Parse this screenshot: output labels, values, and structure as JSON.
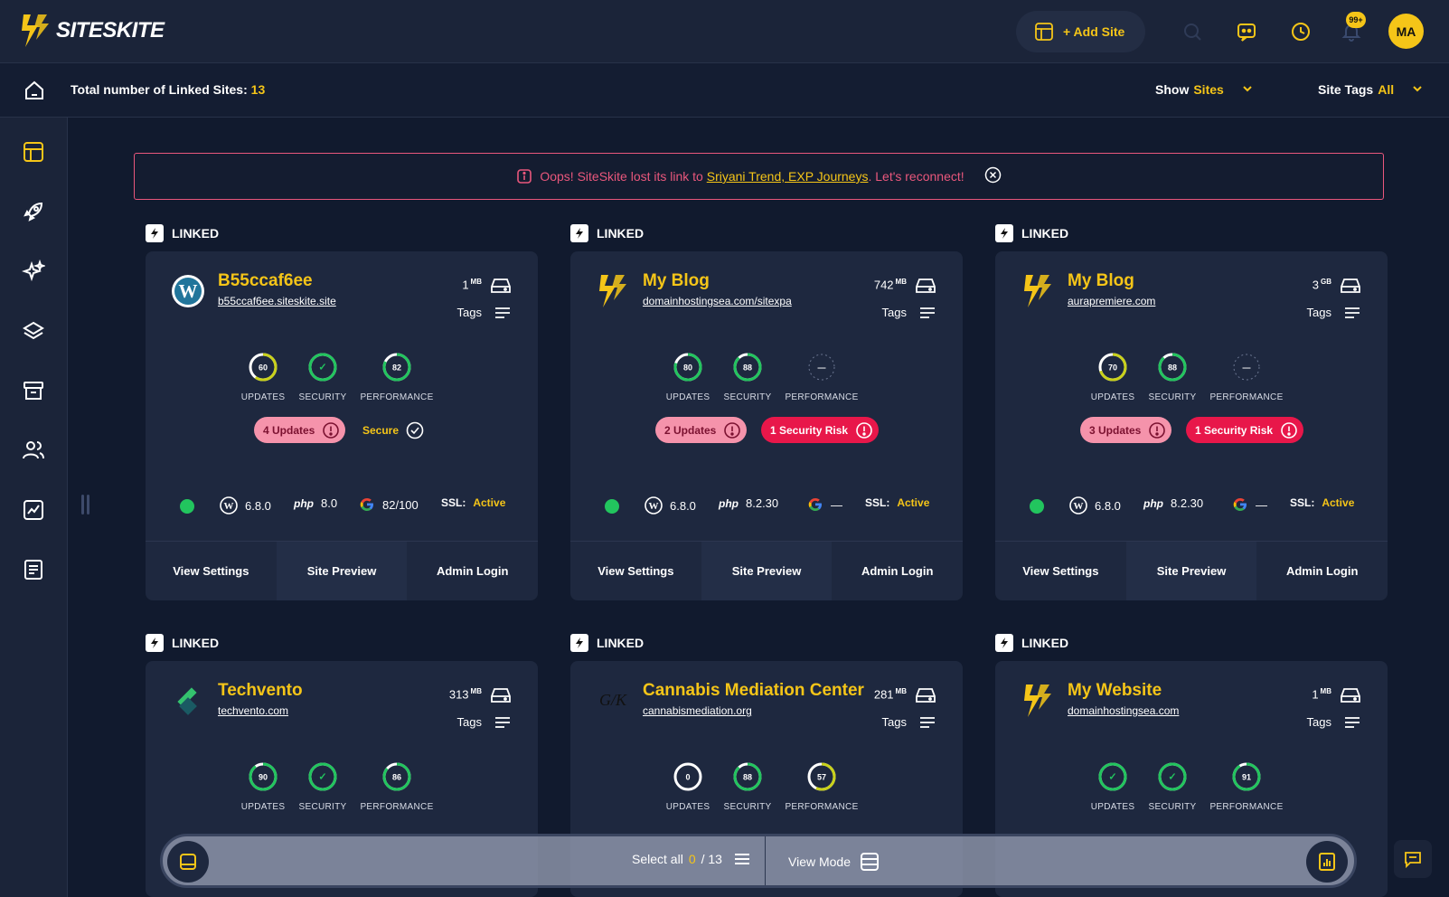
{
  "app": {
    "name": "SITESKITE"
  },
  "topbar": {
    "add_site_label": "+ Add Site",
    "notification_count": "99+",
    "avatar_initials": "MA"
  },
  "subbar": {
    "total_label": "Total number of Linked Sites:",
    "total_value": "13",
    "show_label": "Show",
    "show_value": "Sites",
    "tags_label": "Site Tags",
    "tags_value": "All"
  },
  "alert": {
    "prefix": "Oops! SiteSkite lost its link to",
    "sites": "Sriyani Trend, EXP Journeys",
    "suffix": ". Let's reconnect!"
  },
  "colors": {
    "accent": "#f5c518",
    "bg": "#111a2e",
    "card": "#1e283f",
    "green": "#22c55e",
    "danger": "#e8174a",
    "pink": "#f593ab"
  },
  "labels": {
    "linked": "LINKED",
    "tags": "Tags",
    "updates": "UPDATES",
    "security": "SECURITY",
    "performance": "PERFORMANCE",
    "php": "php",
    "ssl": "SSL:",
    "view_settings": "View Settings",
    "site_preview": "Site Preview",
    "admin_login": "Admin Login"
  },
  "sites": [
    {
      "name": "B55ccaf6ee",
      "url": "b55ccaf6ee.siteskite.site",
      "size": "1",
      "unit": "MB",
      "logo": "wordpress-logo",
      "updates": "60",
      "updates_pct": 0.6,
      "security": "✓",
      "security_pct": 1,
      "performance": "82",
      "performance_pct": 0.82,
      "updates_pill": "4 Updates",
      "security_pill": "Secure",
      "security_pill_type": "secure",
      "wp": "6.8.0",
      "php": "8.0",
      "google": "82/100",
      "ssl": "Active"
    },
    {
      "name": "My Blog",
      "url": "domainhostingsea.com/sitexpa",
      "size": "742",
      "unit": "MB",
      "logo": "bolt-logo",
      "updates": "80",
      "updates_pct": 0.8,
      "security": "88",
      "security_pct": 0.88,
      "performance": "—",
      "performance_pct": 0,
      "updates_pill": "2 Updates",
      "security_pill": "1 Security Risk",
      "security_pill_type": "risk",
      "wp": "6.8.0",
      "php": "8.2.30",
      "google": "—",
      "ssl": "Active"
    },
    {
      "name": "My Blog",
      "url": "aurapremiere.com",
      "size": "3",
      "unit": "GB",
      "logo": "bolt-logo",
      "updates": "70",
      "updates_pct": 0.7,
      "security": "88",
      "security_pct": 0.88,
      "performance": "—",
      "performance_pct": 0,
      "updates_pill": "3 Updates",
      "security_pill": "1 Security Risk",
      "security_pill_type": "risk",
      "wp": "6.8.0",
      "php": "8.2.30",
      "google": "—",
      "ssl": "Active"
    },
    {
      "name": "Techvento",
      "url": "techvento.com",
      "size": "313",
      "unit": "MB",
      "logo": "techvento-logo",
      "updates": "90",
      "updates_pct": 0.9,
      "security": "✓",
      "security_pct": 1,
      "performance": "86",
      "performance_pct": 0.86
    },
    {
      "name": "Cannabis Mediation Center",
      "url": "cannabismediation.org",
      "size": "281",
      "unit": "MB",
      "logo": "gk-logo",
      "updates": "0",
      "updates_pct": 0,
      "security": "88",
      "security_pct": 0.88,
      "performance": "57",
      "performance_pct": 0.57
    },
    {
      "name": "My Website",
      "url": "domainhostingsea.com",
      "size": "1",
      "unit": "MB",
      "logo": "bolt-logo",
      "updates": "✓",
      "updates_pct": 1,
      "security": "✓",
      "security_pct": 1,
      "performance": "91",
      "performance_pct": 0.91
    }
  ],
  "floatbar": {
    "select_all_label": "Select all",
    "selected": "0",
    "total": "/ 13",
    "view_mode_label": "View Mode"
  }
}
